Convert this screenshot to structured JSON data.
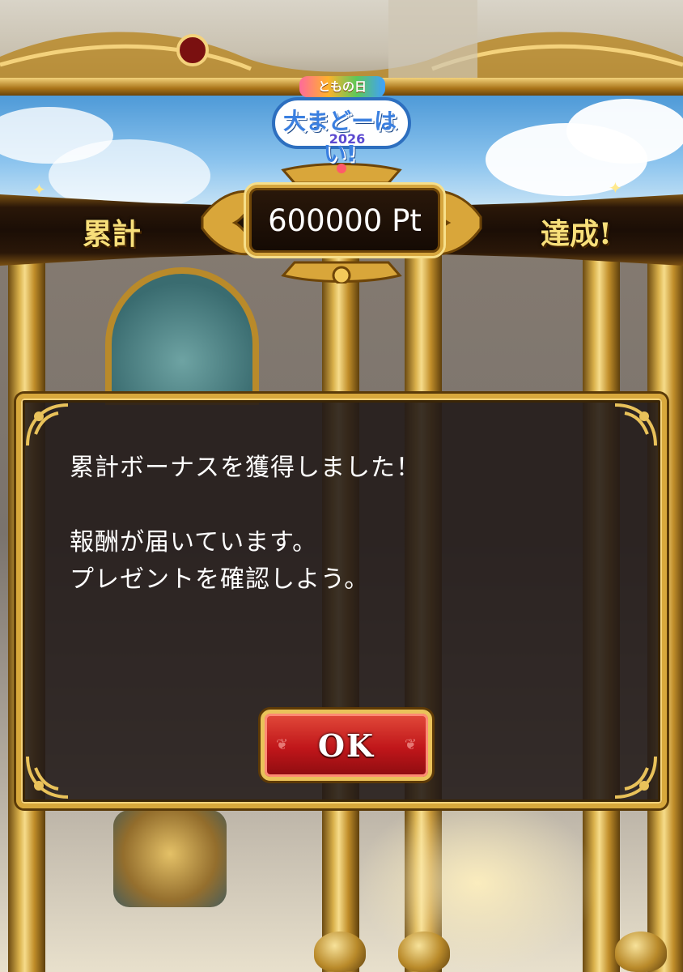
{
  "banner": {
    "logo_top": "ともの日",
    "logo_main": "大まどーはい!",
    "logo_year": "2026",
    "left_label": "累計",
    "points": "600000 Pt",
    "right_label": "達成!"
  },
  "dialog": {
    "line1": "累計ボーナスを獲得しました！",
    "line2": "報酬が届いています。",
    "line3": "プレゼントを確認しよう。",
    "ok_label": "OK"
  },
  "colors": {
    "gold": "#d8a83c",
    "dialog_bg": "#211918",
    "button_red": "#c0161a"
  }
}
